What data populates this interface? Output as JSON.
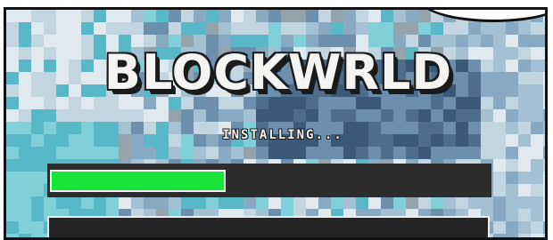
{
  "game": {
    "title": "BLOCKWRLD",
    "status_text": "INSTALLING..."
  },
  "progress": {
    "fraction": 0.4
  },
  "colors": {
    "progress_fill": "#19e43a",
    "progress_track": "#2c2c2c",
    "logo_text": "#f4f4f2"
  },
  "icons": {
    "speech_bubble": "speech-bubble-shape"
  }
}
